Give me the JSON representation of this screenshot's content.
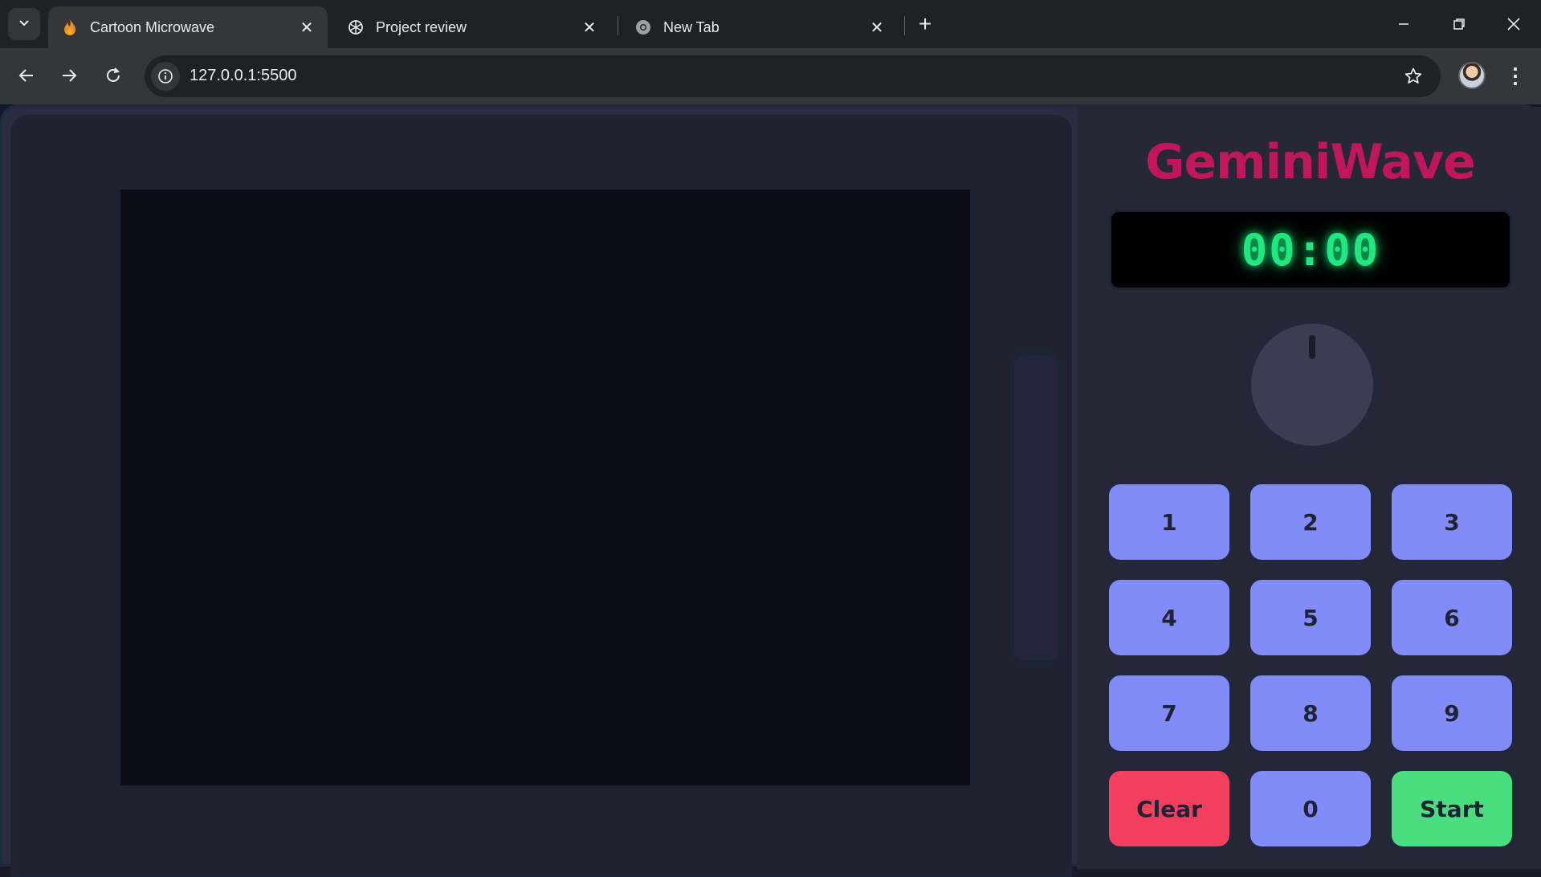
{
  "browser": {
    "tabs": [
      {
        "title": "Cartoon Microwave",
        "icon": "flame-icon",
        "active": true
      },
      {
        "title": "Project review",
        "icon": "openai-icon",
        "active": false
      },
      {
        "title": "New Tab",
        "icon": "chrome-icon",
        "active": false
      }
    ],
    "url": "127.0.0.1:5500"
  },
  "app": {
    "brand": "GeminiWave",
    "display_time": "00:00",
    "keys": [
      "1",
      "2",
      "3",
      "4",
      "5",
      "6",
      "7",
      "8",
      "9",
      "Clear",
      "0",
      "Start"
    ]
  },
  "colors": {
    "brand": "#c0175b",
    "display_text": "#1ee87f",
    "key": "#818cf8",
    "clear": "#f43f5e",
    "start": "#4ade80"
  }
}
